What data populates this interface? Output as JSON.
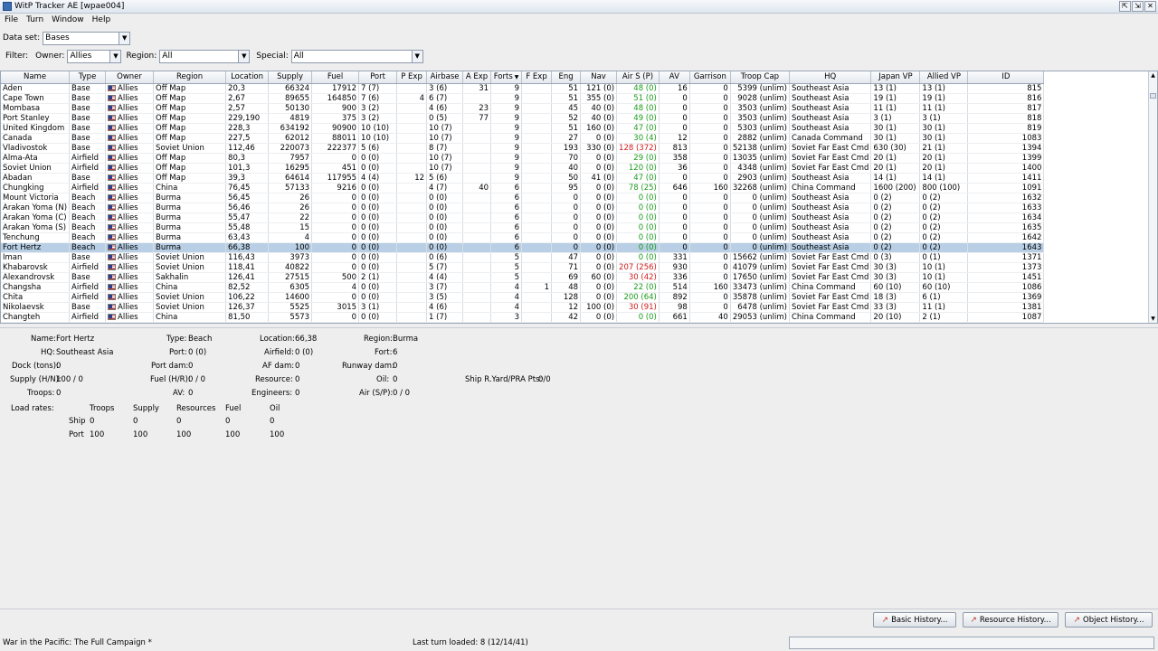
{
  "window": {
    "title": "WitP Tracker AE [wpae004]",
    "buttons": [
      "⇱",
      "⇲",
      "✕"
    ]
  },
  "menu": [
    "File",
    "Turn",
    "Window",
    "Help"
  ],
  "dataset": {
    "label": "Data set:",
    "value": "Bases"
  },
  "filter": {
    "label": "Filter:",
    "owner_label": "Owner:",
    "owner": "Allies",
    "region_label": "Region:",
    "region": "All",
    "special_label": "Special:",
    "special": "All"
  },
  "table": {
    "columns": [
      "Name",
      "Type",
      "Owner",
      "Region",
      "Location",
      "Supply",
      "Fuel",
      "Port",
      "P Exp",
      "Airbase",
      "A Exp",
      "Forts",
      "F Exp",
      "Eng",
      "Nav",
      "Air S (P)",
      "AV",
      "Garrison",
      "Troop Cap",
      "HQ",
      "Japan VP",
      "Allied VP",
      "ID"
    ],
    "sort_arrow": "▼",
    "rows": [
      [
        "Aden",
        "Base",
        "Allies",
        "Off Map",
        "20,3",
        "66324",
        "17912",
        "7 (7)",
        "",
        "3 (6)",
        "31",
        "9",
        "",
        "51",
        "121 (0)",
        "48 (0)",
        "16",
        "0",
        "5399 (unlim)",
        "Southeast Asia",
        "13 (1)",
        "13 (1)",
        "815"
      ],
      [
        "Cape Town",
        "Base",
        "Allies",
        "Off Map",
        "2,67",
        "89655",
        "164850",
        "7 (6)",
        "4",
        "6 (7)",
        "",
        "9",
        "",
        "51",
        "355 (0)",
        "51 (0)",
        "0",
        "0",
        "9028 (unlim)",
        "Southeast Asia",
        "19 (1)",
        "19 (1)",
        "816"
      ],
      [
        "Mombasa",
        "Base",
        "Allies",
        "Off Map",
        "2,57",
        "50130",
        "900",
        "3 (2)",
        "",
        "4 (6)",
        "23",
        "9",
        "",
        "45",
        "40 (0)",
        "48 (0)",
        "0",
        "0",
        "3503 (unlim)",
        "Southeast Asia",
        "11 (1)",
        "11 (1)",
        "817"
      ],
      [
        "Port Stanley",
        "Base",
        "Allies",
        "Off Map",
        "229,190",
        "4819",
        "375",
        "3 (2)",
        "",
        "0 (5)",
        "77",
        "9",
        "",
        "52",
        "40 (0)",
        "49 (0)",
        "0",
        "0",
        "3503 (unlim)",
        "Southeast Asia",
        "3 (1)",
        "3 (1)",
        "818"
      ],
      [
        "United Kingdom",
        "Base",
        "Allies",
        "Off Map",
        "228,3",
        "634192",
        "90900",
        "10 (10)",
        "",
        "10 (7)",
        "",
        "9",
        "",
        "51",
        "160 (0)",
        "47 (0)",
        "0",
        "0",
        "5303 (unlim)",
        "Southeast Asia",
        "30 (1)",
        "30 (1)",
        "819"
      ],
      [
        "Canada",
        "Base",
        "Allies",
        "Off Map",
        "227,5",
        "62012",
        "88011",
        "10 (10)",
        "",
        "10 (7)",
        "",
        "9",
        "",
        "27",
        "0 (0)",
        "30 (4)",
        "12",
        "0",
        "2882 (unlim)",
        "Canada Command",
        "30 (1)",
        "30 (1)",
        "1083"
      ],
      [
        "Vladivostok",
        "Base",
        "Allies",
        "Soviet Union",
        "112,46",
        "220073",
        "222377",
        "5 (6)",
        "",
        "8 (7)",
        "",
        "9",
        "",
        "193",
        "330 (0)",
        "128 (372)",
        "813",
        "0",
        "52138 (unlim)",
        "Soviet Far East Cmd",
        "630 (30)",
        "21 (1)",
        "1394"
      ],
      [
        "Alma-Ata",
        "Airfield",
        "Allies",
        "Off Map",
        "80,3",
        "7957",
        "0",
        "0 (0)",
        "",
        "10 (7)",
        "",
        "9",
        "",
        "70",
        "0 (0)",
        "29 (0)",
        "358",
        "0",
        "13035 (unlim)",
        "Soviet Far East Cmd",
        "20 (1)",
        "20 (1)",
        "1399"
      ],
      [
        "Soviet Union",
        "Airfield",
        "Allies",
        "Off Map",
        "101,3",
        "16295",
        "451",
        "0 (0)",
        "",
        "10 (7)",
        "",
        "9",
        "",
        "40",
        "0 (0)",
        "120 (0)",
        "36",
        "0",
        "4348 (unlim)",
        "Soviet Far East Cmd",
        "20 (1)",
        "20 (1)",
        "1400"
      ],
      [
        "Abadan",
        "Base",
        "Allies",
        "Off Map",
        "39,3",
        "64614",
        "117955",
        "4 (4)",
        "12",
        "5 (6)",
        "",
        "9",
        "",
        "50",
        "41 (0)",
        "47 (0)",
        "0",
        "0",
        "2903 (unlim)",
        "Southeast Asia",
        "14 (1)",
        "14 (1)",
        "1411"
      ],
      [
        "Chungking",
        "Airfield",
        "Allies",
        "China",
        "76,45",
        "57133",
        "9216",
        "0 (0)",
        "",
        "4 (7)",
        "40",
        "6",
        "",
        "95",
        "0 (0)",
        "78 (25)",
        "646",
        "160",
        "32268 (unlim)",
        "China Command",
        "1600 (200)",
        "800 (100)",
        "1091"
      ],
      [
        "Mount Victoria",
        "Beach",
        "Allies",
        "Burma",
        "56,45",
        "26",
        "0",
        "0 (0)",
        "",
        "0 (0)",
        "",
        "6",
        "",
        "0",
        "0 (0)",
        "0 (0)",
        "0",
        "0",
        "0 (unlim)",
        "Southeast Asia",
        "0 (2)",
        "0 (2)",
        "1632"
      ],
      [
        "Arakan Yoma (N)",
        "Beach",
        "Allies",
        "Burma",
        "56,46",
        "26",
        "0",
        "0 (0)",
        "",
        "0 (0)",
        "",
        "6",
        "",
        "0",
        "0 (0)",
        "0 (0)",
        "0",
        "0",
        "0 (unlim)",
        "Southeast Asia",
        "0 (2)",
        "0 (2)",
        "1633"
      ],
      [
        "Arakan Yoma (C)",
        "Beach",
        "Allies",
        "Burma",
        "55,47",
        "22",
        "0",
        "0 (0)",
        "",
        "0 (0)",
        "",
        "6",
        "",
        "0",
        "0 (0)",
        "0 (0)",
        "0",
        "0",
        "0 (unlim)",
        "Southeast Asia",
        "0 (2)",
        "0 (2)",
        "1634"
      ],
      [
        "Arakan Yoma (S)",
        "Beach",
        "Allies",
        "Burma",
        "55,48",
        "15",
        "0",
        "0 (0)",
        "",
        "0 (0)",
        "",
        "6",
        "",
        "0",
        "0 (0)",
        "0 (0)",
        "0",
        "0",
        "0 (unlim)",
        "Southeast Asia",
        "0 (2)",
        "0 (2)",
        "1635"
      ],
      [
        "Tenchung",
        "Beach",
        "Allies",
        "Burma",
        "63,43",
        "4",
        "0",
        "0 (0)",
        "",
        "0 (0)",
        "",
        "6",
        "",
        "0",
        "0 (0)",
        "0 (0)",
        "0",
        "0",
        "0 (unlim)",
        "Southeast Asia",
        "0 (2)",
        "0 (2)",
        "1642"
      ],
      [
        "Fort Hertz",
        "Beach",
        "Allies",
        "Burma",
        "66,38",
        "100",
        "0",
        "0 (0)",
        "",
        "0 (0)",
        "",
        "6",
        "",
        "0",
        "0 (0)",
        "0 (0)",
        "0",
        "0",
        "0 (unlim)",
        "Southeast Asia",
        "0 (2)",
        "0 (2)",
        "1643"
      ],
      [
        "Iman",
        "Base",
        "Allies",
        "Soviet Union",
        "116,43",
        "3973",
        "0",
        "0 (0)",
        "",
        "0 (6)",
        "",
        "5",
        "",
        "47",
        "0 (0)",
        "0 (0)",
        "331",
        "0",
        "15662 (unlim)",
        "Soviet Far East Cmd",
        "0 (3)",
        "0 (1)",
        "1371"
      ],
      [
        "Khabarovsk",
        "Airfield",
        "Allies",
        "Soviet Union",
        "118,41",
        "40822",
        "0",
        "0 (0)",
        "",
        "5 (7)",
        "",
        "5",
        "",
        "71",
        "0 (0)",
        "207 (256)",
        "930",
        "0",
        "41079 (unlim)",
        "Soviet Far East Cmd",
        "30 (3)",
        "10 (1)",
        "1373"
      ],
      [
        "Alexandrovsk",
        "Base",
        "Allies",
        "Sakhalin",
        "126,41",
        "27515",
        "500",
        "2 (1)",
        "",
        "4 (4)",
        "",
        "5",
        "",
        "69",
        "60 (0)",
        "30 (42)",
        "336",
        "0",
        "17650 (unlim)",
        "Soviet Far East Cmd",
        "30 (3)",
        "10 (1)",
        "1451"
      ],
      [
        "Changsha",
        "Airfield",
        "Allies",
        "China",
        "82,52",
        "6305",
        "4",
        "0 (0)",
        "",
        "3 (7)",
        "",
        "4",
        "1",
        "48",
        "0 (0)",
        "22 (0)",
        "514",
        "160",
        "33473 (unlim)",
        "China Command",
        "60 (10)",
        "60 (10)",
        "1086"
      ],
      [
        "Chita",
        "Airfield",
        "Allies",
        "Soviet Union",
        "106,22",
        "14600",
        "0",
        "0 (0)",
        "",
        "3 (5)",
        "",
        "4",
        "",
        "128",
        "0 (0)",
        "200 (64)",
        "892",
        "0",
        "35878 (unlim)",
        "Soviet Far East Cmd",
        "18 (3)",
        "6 (1)",
        "1369"
      ],
      [
        "Nikolaevsk",
        "Base",
        "Allies",
        "Soviet Union",
        "126,37",
        "5525",
        "3015",
        "3 (1)",
        "",
        "4 (6)",
        "",
        "4",
        "",
        "12",
        "100 (0)",
        "30 (91)",
        "98",
        "0",
        "6478 (unlim)",
        "Soviet Far East Cmd",
        "33 (3)",
        "11 (1)",
        "1381"
      ],
      [
        "Changteh",
        "Airfield",
        "Allies",
        "China",
        "81,50",
        "5573",
        "0",
        "0 (0)",
        "",
        "1 (7)",
        "",
        "3",
        "",
        "42",
        "0 (0)",
        "0 (0)",
        "661",
        "40",
        "29053 (unlim)",
        "China Command",
        "20 (10)",
        "2 (1)",
        "1087"
      ],
      [
        "Chihkiang",
        "Airfield",
        "Allies",
        "China",
        "78,50",
        "6",
        "0",
        "0 (0)",
        "",
        "1 (5)",
        "",
        "3",
        "",
        "0",
        "0 (0)",
        "0 (0)",
        "0",
        "0",
        "0 (unlim)",
        "China Command",
        "20 (10)",
        "2 (1)",
        "1090"
      ]
    ],
    "selected_index": 16,
    "airs_colors": [
      "green",
      "green",
      "green",
      "green",
      "green",
      "green",
      "red",
      "green",
      "green",
      "green",
      "green",
      "green",
      "green",
      "green",
      "green",
      "green",
      "green",
      "green",
      "red",
      "red",
      "green",
      "green",
      "red",
      "green",
      "green"
    ]
  },
  "detail": {
    "name_label": "Name:",
    "name": "Fort Hertz",
    "type_label": "Type:",
    "type": "Beach",
    "location_label": "Location:",
    "location": "66,38",
    "region_label": "Region:",
    "region": "Burma",
    "hq_label": "HQ:",
    "hq": "Southeast Asia",
    "port_label": "Port:",
    "port": "0 (0)",
    "airfield_label": "Airfield:",
    "airfield": "0 (0)",
    "fort_label": "Fort:",
    "fort": "6",
    "dock_label": "Dock (tons):",
    "dock": "0",
    "portdam_label": "Port dam:",
    "portdam": "0",
    "afdam_label": "AF dam:",
    "afdam": "0",
    "runway_label": "Runway dam:",
    "runway": "0",
    "supply_label": "Supply (H/N):",
    "supply": "100 / 0",
    "fuel_label": "Fuel (H/R):",
    "fuel": "0 / 0",
    "resource_label": "Resource:",
    "resource": "0",
    "oil_label": "Oil:",
    "oil": "0",
    "shipyard_label": "Ship R.Yard/PRA Pts:",
    "shipyard": "0/0",
    "troops_label": "Troops:",
    "troops": "0",
    "av_label": "AV:",
    "av": "0",
    "engineers_label": "Engineers:",
    "engineers": "0",
    "airsp_label": "Air (S/P):",
    "airsp": "0 / 0",
    "load_label": "Load rates:",
    "load_cols": [
      "Troops",
      "Supply",
      "Resources",
      "Fuel",
      "Oil"
    ],
    "load_ship_label": "Ship",
    "load_ship": [
      "0",
      "0",
      "0",
      "0",
      "0"
    ],
    "load_port_label": "Port",
    "load_port": [
      "100",
      "100",
      "100",
      "100",
      "100"
    ]
  },
  "buttons": {
    "basic_history": "Basic History...",
    "resource_history": "Resource History...",
    "object_history": "Object History..."
  },
  "status": {
    "campaign": "War in the Pacific: The Full Campaign  *",
    "last_turn": "Last turn loaded: 8 (12/14/41)"
  },
  "colors": {
    "selected_row": "#b8cfe5",
    "positive": "#1a9a1a",
    "negative": "#d01919"
  }
}
